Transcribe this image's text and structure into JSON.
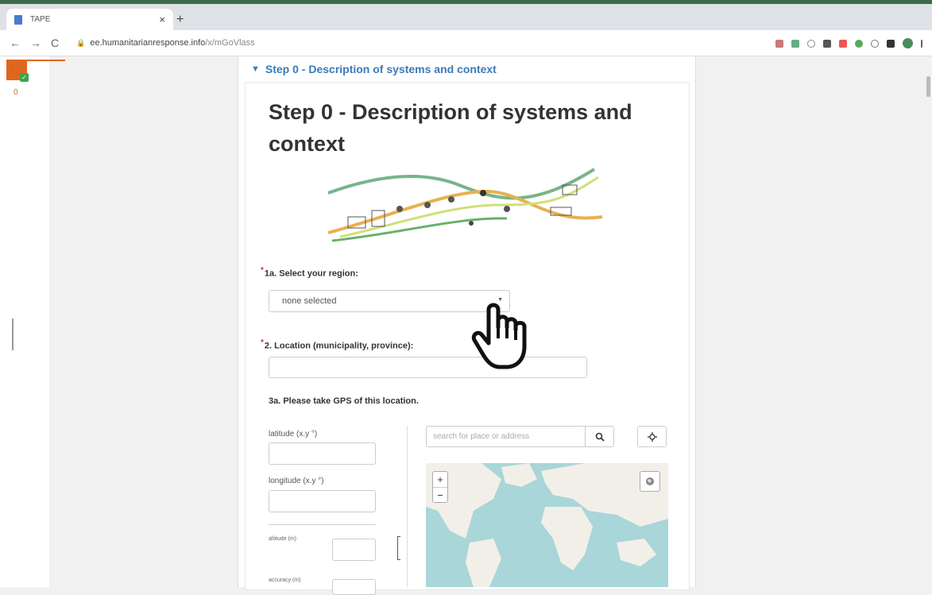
{
  "browser": {
    "tab_title": "TAPE",
    "tab_close": "×",
    "new_tab": "+",
    "nav_back": "←",
    "nav_forward": "→",
    "nav_reload": "C",
    "url_host": "ee.humanitarianresponse.info",
    "url_path": "/x/mGoVlass"
  },
  "sidebar": {
    "progress_count": "0"
  },
  "form": {
    "group_header": "Step 0 - Description of systems and context",
    "page_title": "Step 0 - Description of systems and context",
    "q1": {
      "required_mark": "*",
      "label": "1a. Select your region:",
      "selected_value": "none selected"
    },
    "q2": {
      "required_mark": "*",
      "label": "2. Location (municipality, province):",
      "value": ""
    },
    "q3": {
      "label": "3a. Please take GPS of this location.",
      "latitude_label": "latitude (x.y °)",
      "longitude_label": "longitude (x.y °)",
      "altitude_label": "altitude (m)",
      "accuracy_label": "accuracy (m)",
      "search_placeholder": "search for place or address",
      "zoom_in": "+",
      "zoom_out": "−"
    }
  },
  "colors": {
    "accent": "#3a7bb8",
    "brand": "#e06620",
    "map_water": "#a9d6d8",
    "map_land": "#f2efe9"
  }
}
